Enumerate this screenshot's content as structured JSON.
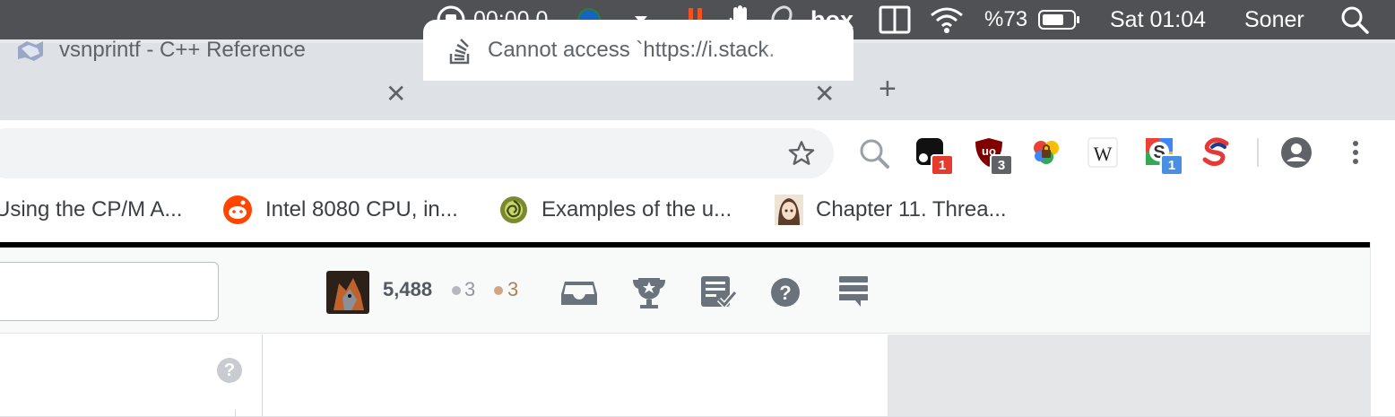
{
  "menubar": {
    "recording_time": "00:00.0",
    "box_label": "box",
    "battery_percent": "%73",
    "clock": "Sat 01:04",
    "user": "Soner"
  },
  "tabs": [
    {
      "title": "vsnprintf - C++ Reference",
      "active": false
    },
    {
      "title": "Cannot access `https://i.stack.",
      "active": true
    }
  ],
  "new_tab_label": "+",
  "extensions": [
    {
      "name": "ext-black",
      "badge": "1",
      "badge_color": "#e33b2e"
    },
    {
      "name": "ublock",
      "badge": "3",
      "badge_color": "#5f6368"
    },
    {
      "name": "ext-lock",
      "badge": ""
    },
    {
      "name": "wikipedia",
      "badge": ""
    },
    {
      "name": "ext-s",
      "badge": "1",
      "badge_color": "#4a90e2"
    },
    {
      "name": "ext-s-red",
      "badge": ""
    }
  ],
  "bookmarks": [
    {
      "label": "Using the CP/M A..."
    },
    {
      "label": "Intel 8080 CPU, in..."
    },
    {
      "label": "Examples of the u..."
    },
    {
      "label": "Chapter 11. Threa..."
    }
  ],
  "stack": {
    "reputation": "5,488",
    "silver_badges": "3",
    "bronze_badges": "3",
    "silver_color": "#b4b8bc",
    "bronze_color": "#d1a684",
    "help_icon_label": "?"
  },
  "colors": {
    "menubar_bg": "#4f5155",
    "tabstrip_bg": "#dee1e6",
    "so_icon_gray": "#6a737c"
  }
}
